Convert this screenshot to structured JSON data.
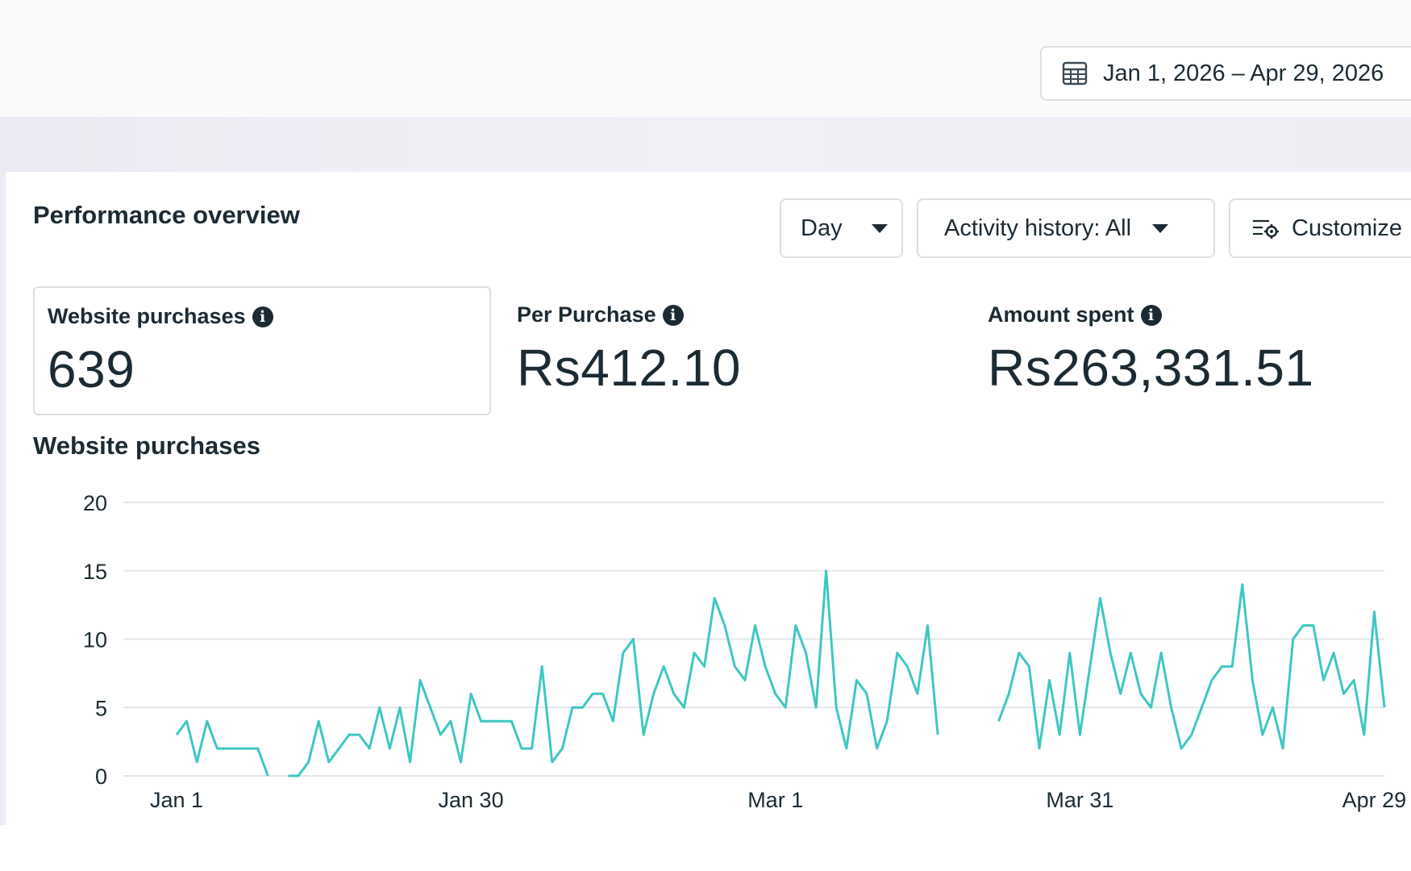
{
  "header": {
    "date_range": "Jan 1, 2026 – Apr 29, 2026",
    "calendar_icon": "calendar-icon"
  },
  "overview": {
    "title": "Performance overview",
    "controls": {
      "day": "Day",
      "activity": "Activity history: All",
      "customize": "Customize"
    }
  },
  "metrics": [
    {
      "label": "Website purchases",
      "value": "639"
    },
    {
      "label": "Per Purchase",
      "value": "Rs412.10"
    },
    {
      "label": "Amount spent",
      "value": "Rs263,331.51"
    }
  ],
  "colors": {
    "line": "#3ec7c2",
    "grid": "#e3e5e8",
    "text": "#1c2b33"
  },
  "chart_data": {
    "type": "line",
    "title": "Website purchases",
    "xlabel": "",
    "ylabel": "",
    "ylim": [
      0,
      20
    ],
    "yticks": [
      "0",
      "5",
      "10",
      "15",
      "20"
    ],
    "xtick_labels": [
      "Jan 1",
      "Jan 30",
      "Mar 1",
      "Mar 31",
      "Apr 29"
    ],
    "grid": true,
    "series": [
      {
        "values": [
          3,
          4,
          1,
          4,
          2,
          2,
          2,
          2,
          2,
          0,
          null,
          0,
          0,
          1,
          4,
          1,
          2,
          3,
          3,
          2,
          5,
          2,
          5,
          1,
          7,
          5,
          3,
          4,
          1,
          6,
          4,
          4,
          4,
          4,
          2,
          2,
          8,
          1,
          2,
          5,
          5,
          6,
          6,
          4,
          9,
          10,
          3,
          6,
          8,
          6,
          5,
          9,
          8,
          13,
          11,
          8,
          7,
          11,
          8,
          6,
          5,
          11,
          9,
          5,
          15,
          5,
          2,
          7,
          6,
          2,
          4,
          9,
          8,
          6,
          11,
          3,
          null,
          null,
          null,
          null,
          null,
          4,
          6,
          9,
          8,
          2,
          7,
          3,
          9,
          3,
          8,
          13,
          9,
          6,
          9,
          6,
          5,
          9,
          5,
          2,
          3,
          5,
          7,
          8,
          8,
          14,
          7,
          3,
          5,
          2,
          10,
          11,
          11,
          7,
          9,
          6,
          7,
          3,
          12,
          5
        ]
      }
    ]
  }
}
